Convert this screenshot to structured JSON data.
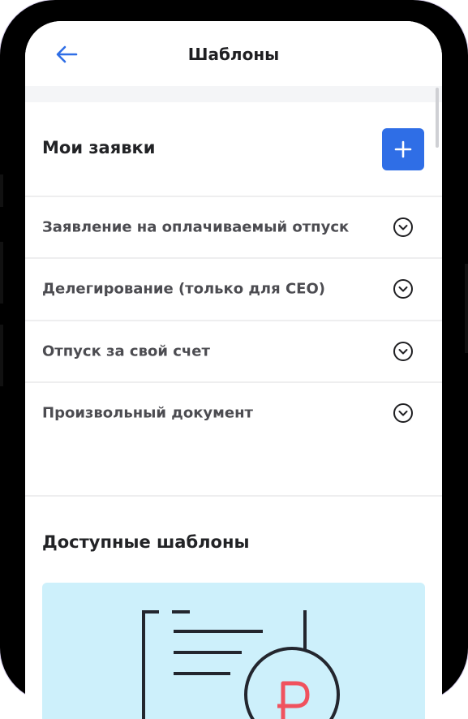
{
  "header": {
    "title": "Шаблоны",
    "back_icon": "arrow-left-icon"
  },
  "colors": {
    "accent": "#2f6ee6",
    "illustration_bg": "#cdf0fb",
    "illustration_accent": "#f0525e"
  },
  "my_requests": {
    "title": "Мои заявки",
    "add_icon": "plus-icon",
    "items": [
      {
        "label": "Заявление на оплачиваемый отпуск",
        "icon": "chevron-down-circle-icon"
      },
      {
        "label": "Делегирование (только для CEO)",
        "icon": "chevron-down-circle-icon"
      },
      {
        "label": "Отпуск за свой счет",
        "icon": "chevron-down-circle-icon"
      },
      {
        "label": "Произвольный документ",
        "icon": "chevron-down-circle-icon"
      }
    ]
  },
  "available_templates": {
    "title": "Доступные шаблоны",
    "card_icon": "document-ruble-illustration"
  }
}
